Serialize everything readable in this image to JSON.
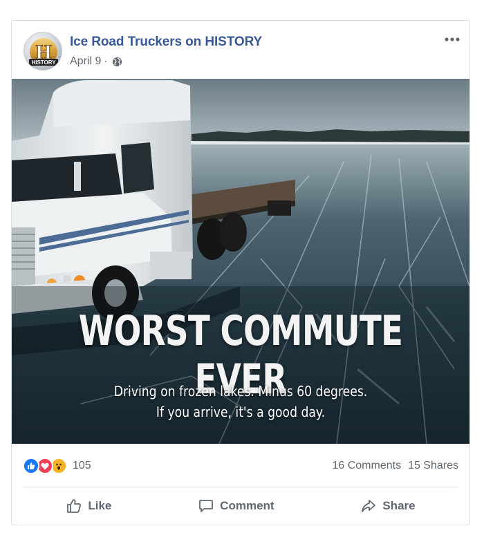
{
  "post": {
    "page_name": "Ice Road Truckers on HISTORY",
    "date": "April 9",
    "separator": "·",
    "avatar_logo_letter": "H",
    "avatar_logo_text": "HISTORY",
    "media": {
      "headline": "WORST COMMUTE EVER",
      "subline_1": "Driving on frozen lakes.  Minus 60 degrees.",
      "subline_2": "If you arrive, it's a good day."
    },
    "reactions": {
      "types": [
        "like-icon",
        "love-icon",
        "wow-icon"
      ],
      "count": "105"
    },
    "comments": "16 Comments",
    "shares": "15 Shares",
    "actions": {
      "like": "Like",
      "comment": "Comment",
      "share": "Share"
    }
  },
  "colors": {
    "page_name": "#385898",
    "secondary_text": "#606770",
    "like": "#1877f2",
    "love": "#f33e58",
    "wow": "#f7b125"
  }
}
